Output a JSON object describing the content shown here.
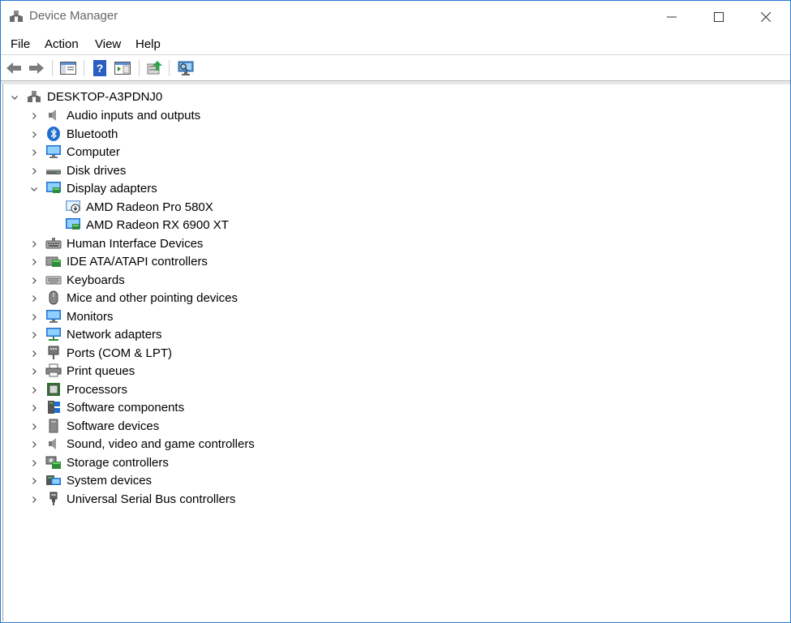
{
  "window": {
    "title": "Device Manager",
    "menu": [
      "File",
      "Action",
      "View",
      "Help"
    ]
  },
  "tree": {
    "root": {
      "label": "DESKTOP-A3PDNJ0",
      "expanded": true
    },
    "categories": [
      {
        "label": "Audio inputs and outputs",
        "icon": "speaker-icon",
        "expanded": false
      },
      {
        "label": "Bluetooth",
        "icon": "bluetooth-icon",
        "expanded": false
      },
      {
        "label": "Computer",
        "icon": "computer-icon",
        "expanded": false
      },
      {
        "label": "Disk drives",
        "icon": "disk-drive-icon",
        "expanded": false
      },
      {
        "label": "Display adapters",
        "icon": "display-adapter-icon",
        "expanded": true,
        "children": [
          {
            "label": "AMD Radeon Pro 580X",
            "icon": "display-adapter-disabled-icon"
          },
          {
            "label": "AMD Radeon RX 6900 XT",
            "icon": "display-adapter-icon"
          }
        ]
      },
      {
        "label": "Human Interface Devices",
        "icon": "hid-icon",
        "expanded": false
      },
      {
        "label": "IDE ATA/ATAPI controllers",
        "icon": "ide-controller-icon",
        "expanded": false
      },
      {
        "label": "Keyboards",
        "icon": "keyboard-icon",
        "expanded": false
      },
      {
        "label": "Mice and other pointing devices",
        "icon": "mouse-icon",
        "expanded": false
      },
      {
        "label": "Monitors",
        "icon": "monitor-icon",
        "expanded": false
      },
      {
        "label": "Network adapters",
        "icon": "network-adapter-icon",
        "expanded": false
      },
      {
        "label": "Ports (COM & LPT)",
        "icon": "port-icon",
        "expanded": false
      },
      {
        "label": "Print queues",
        "icon": "printer-icon",
        "expanded": false
      },
      {
        "label": "Processors",
        "icon": "processor-icon",
        "expanded": false
      },
      {
        "label": "Software components",
        "icon": "software-component-icon",
        "expanded": false
      },
      {
        "label": "Software devices",
        "icon": "software-device-icon",
        "expanded": false
      },
      {
        "label": "Sound, video and game controllers",
        "icon": "sound-icon",
        "expanded": false
      },
      {
        "label": "Storage controllers",
        "icon": "storage-controller-icon",
        "expanded": false
      },
      {
        "label": "System devices",
        "icon": "system-device-icon",
        "expanded": false
      },
      {
        "label": "Universal Serial Bus controllers",
        "icon": "usb-icon",
        "expanded": false
      }
    ]
  },
  "toolbar": {
    "buttons": [
      "back-arrow-icon",
      "forward-arrow-icon",
      "show-hide-console-tree-icon",
      "help-icon",
      "properties-icon",
      "update-driver-icon",
      "scan-hardware-icon"
    ]
  },
  "colors": {
    "window_border": "#2b79d6",
    "accent_blue": "#1e6fd0"
  }
}
